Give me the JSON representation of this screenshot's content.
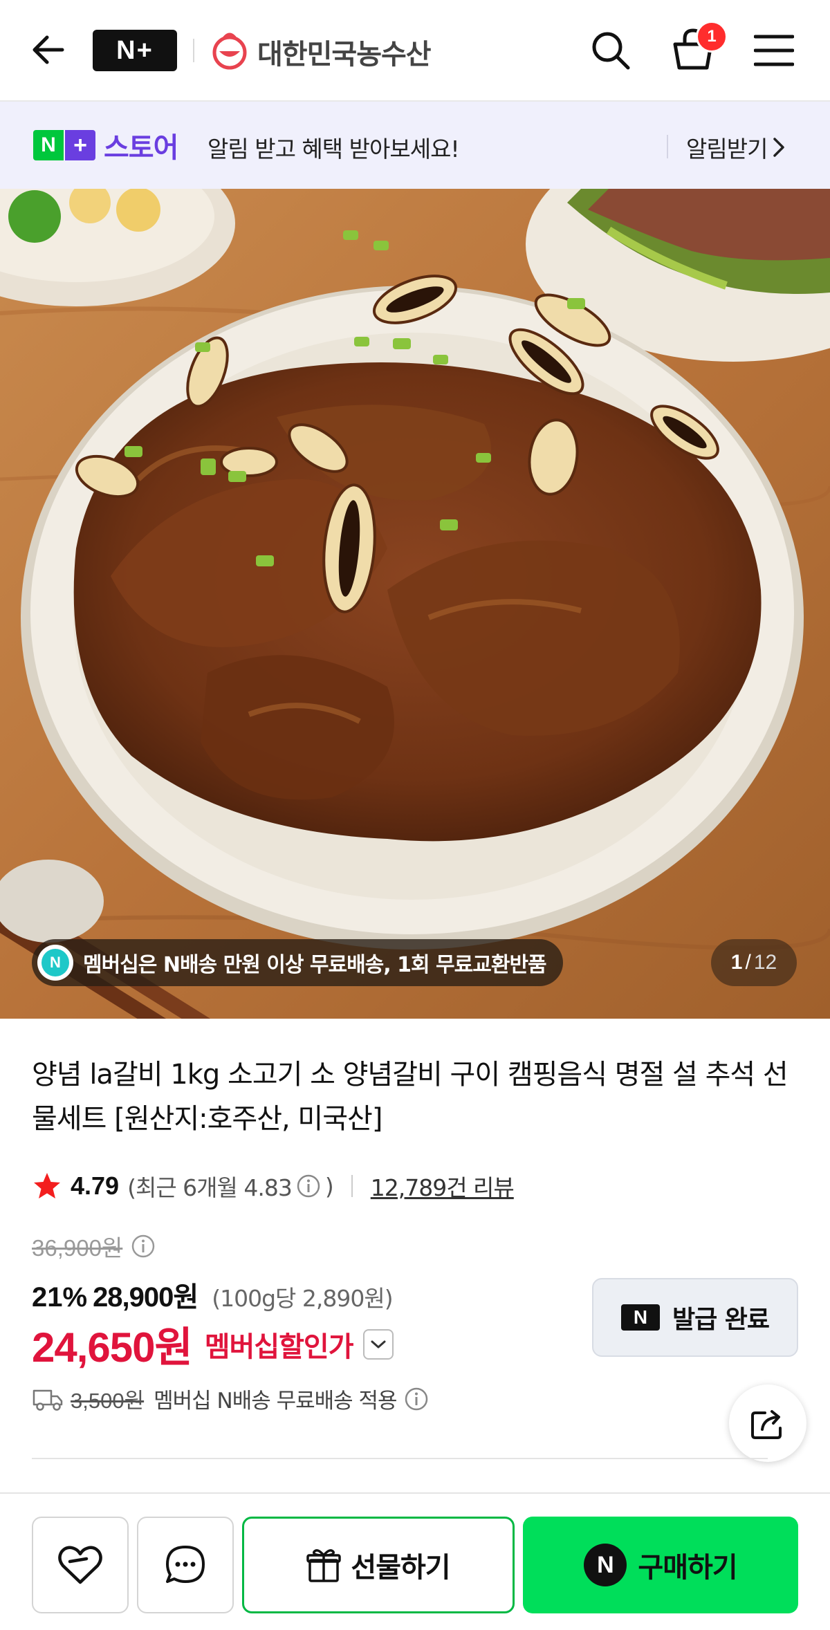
{
  "header": {
    "logo_text": "N+",
    "brand_name": "대한민국농수산",
    "cart_count": "1",
    "icons": [
      "back-arrow-icon",
      "search-icon",
      "cart-icon",
      "menu-icon"
    ]
  },
  "store_banner": {
    "logo_n": "N",
    "logo_plus": "+",
    "logo_word": "스토어",
    "message": "알림 받고 혜택 받아보세요!",
    "cta": "알림받기"
  },
  "hero": {
    "membership_badge": "N",
    "membership_notice": "멤버십은 N배송 만원 이상 무료배송, 1회 무료교환반품",
    "page_current": "1",
    "page_sep": "/",
    "page_total": "12"
  },
  "product": {
    "title": "양념 la갈비 1kg 소고기 소 양념갈비 구이 캠핑음식 명절 설 추석 선물세트 [원산지:호주산, 미국산]",
    "rating": "4.79",
    "rating_recent": "(최근 6개월 4.83",
    "rating_recent_close": ")",
    "review_count": "12,789건 리뷰",
    "original_price": "36,900원",
    "discount_rate": "21%",
    "sale_price": "28,900원",
    "unit_price": "(100g당 2,890원)",
    "member_price": "24,650원",
    "member_price_label": "멤버십할인가",
    "coupon_icon": "N",
    "coupon_label": "발급 완료",
    "shipping_original": "3,500원",
    "shipping_text": "멤버십 N배송 무료배송 적용"
  },
  "bottom_bar": {
    "gift_label": "선물하기",
    "buy_icon": "N",
    "buy_label": "구매하기"
  },
  "colors": {
    "naver_green": "#00de5a",
    "store_purple": "#6a3ee0",
    "member_red": "#e0143c",
    "banner_bg": "#f0f0fc"
  }
}
